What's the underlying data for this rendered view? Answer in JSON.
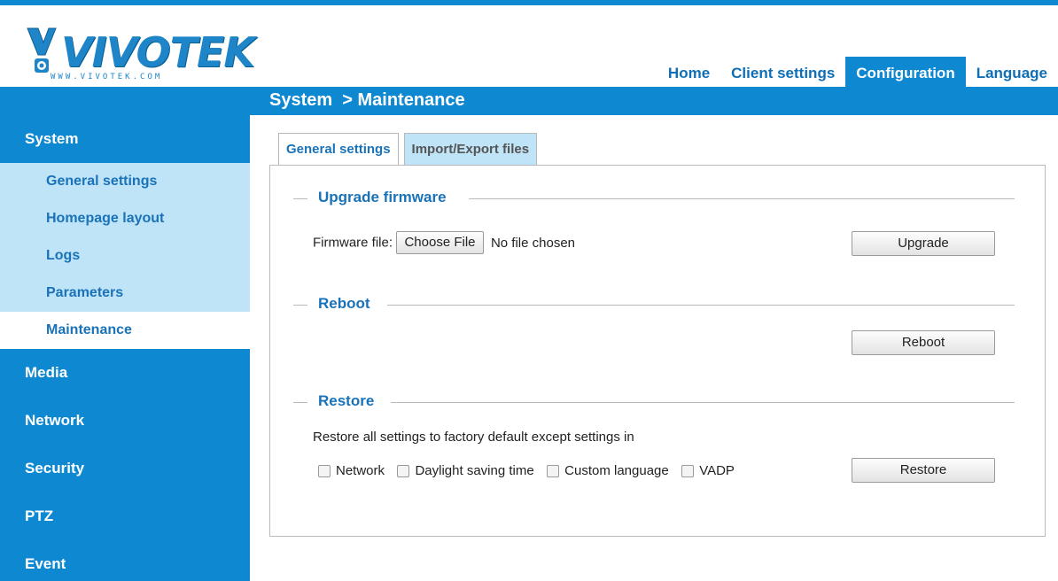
{
  "brand": {
    "name": "VIVOTEK",
    "url_text": "WWW.VIVOTEK.COM"
  },
  "nav": {
    "items": [
      {
        "label": "Home"
      },
      {
        "label": "Client settings"
      },
      {
        "label": "Configuration",
        "active": true
      },
      {
        "label": "Language"
      }
    ]
  },
  "page_title": "System  > Maintenance",
  "sidebar": {
    "system": "System",
    "system_items": [
      {
        "label": "General settings"
      },
      {
        "label": "Homepage layout"
      },
      {
        "label": "Logs"
      },
      {
        "label": "Parameters"
      },
      {
        "label": "Maintenance",
        "active": true
      }
    ],
    "sections": [
      {
        "label": "Media"
      },
      {
        "label": "Network"
      },
      {
        "label": "Security"
      },
      {
        "label": "PTZ"
      },
      {
        "label": "Event"
      }
    ]
  },
  "tabs": [
    {
      "label": "General settings",
      "active": true
    },
    {
      "label": "Import/Export files",
      "active": false
    }
  ],
  "upgrade": {
    "title": "Upgrade firmware",
    "file_label": "Firmware file:",
    "choose_button": "Choose File",
    "file_status": "No file chosen",
    "button": "Upgrade"
  },
  "reboot": {
    "title": "Reboot",
    "button": "Reboot"
  },
  "restore": {
    "title": "Restore",
    "description": "Restore all settings to factory default except settings in",
    "options": [
      {
        "label": "Network",
        "checked": false
      },
      {
        "label": "Daylight saving time",
        "checked": false
      },
      {
        "label": "Custom language",
        "checked": false
      },
      {
        "label": "VADP",
        "checked": false
      }
    ],
    "button": "Restore"
  },
  "colors": {
    "primary": "#0f88d2",
    "submenu_bg": "#bfe3f7",
    "link": "#1a73b8"
  }
}
